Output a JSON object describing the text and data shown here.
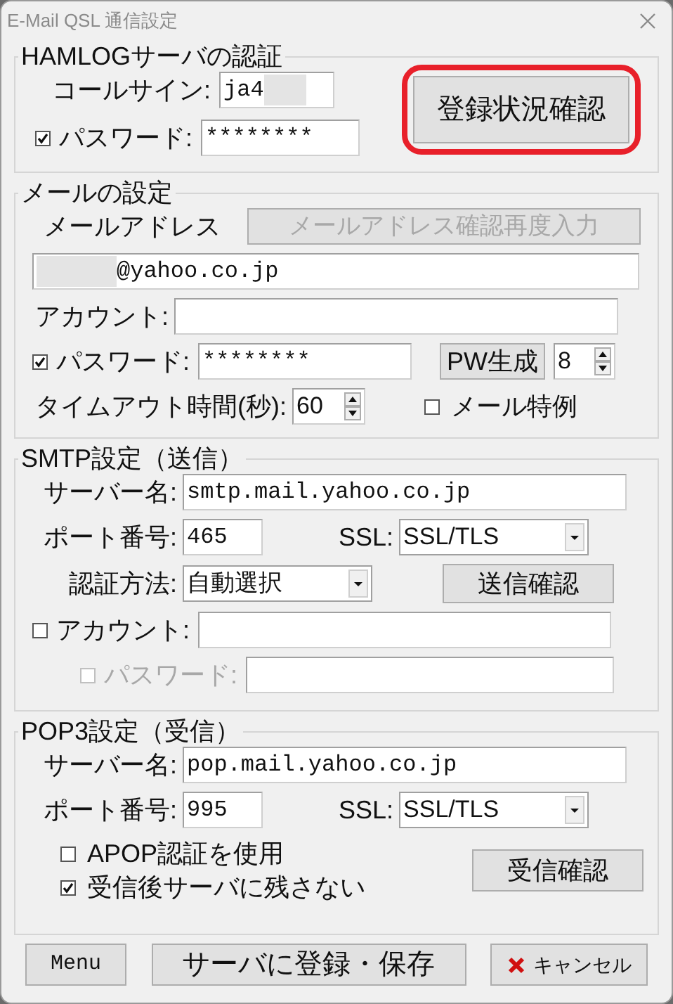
{
  "window": {
    "title": "E-Mail QSL 通信設定"
  },
  "hamlog": {
    "legend": "HAMLOGサーバの認証",
    "callsign_label": "コールサイン:",
    "callsign": "ja4",
    "password_checked": true,
    "password_label": "パスワード:",
    "password": "********",
    "check_button": "登録状況確認",
    "highlighted": true
  },
  "mail": {
    "legend": "メールの設定",
    "address_label": "メールアドレス",
    "reenter_button": {
      "label": "メールアドレス確認再度入力",
      "disabled": true
    },
    "address": "@yahoo.co.jp",
    "account_label": "アカウント:",
    "password_checked": true,
    "password_label": "パスワード:",
    "password": "********",
    "generate_button": "PW生成",
    "length": "8",
    "timeout_label": "タイムアウト時間(秒):",
    "timeout": "60",
    "exception": {
      "label": "メール特例",
      "checked": false
    }
  },
  "smtp": {
    "legend": "SMTP設定（送信）",
    "server_label": "サーバー名:",
    "server": "smtp.mail.yahoo.co.jp",
    "port_label": "ポート番号:",
    "port": "465",
    "ssl_label": "SSL:",
    "ssl": "SSL/TLS",
    "auth_label": "認証方法:",
    "auth": "自動選択",
    "test_button": "送信確認",
    "account": {
      "label": "アカウント:",
      "checked": false
    },
    "password": {
      "label": "パスワード:",
      "checked": false,
      "disabled": true
    }
  },
  "pop3": {
    "legend": "POP3設定（受信）",
    "server_label": "サーバー名:",
    "server": "pop.mail.yahoo.co.jp",
    "port_label": "ポート番号:",
    "port": "995",
    "ssl_label": "SSL:",
    "ssl": "SSL/TLS",
    "options": [
      {
        "label": "APOP認証を使用",
        "checked": false
      },
      {
        "label": "受信後サーバに残さない",
        "checked": true
      }
    ],
    "test_button": "受信確認"
  },
  "buttons": [
    {
      "kind": "plain",
      "label": "Menu"
    },
    {
      "kind": "plain",
      "label": "サーバに登録・保存"
    },
    {
      "kind": "cancel",
      "label": "キャンセル"
    }
  ]
}
